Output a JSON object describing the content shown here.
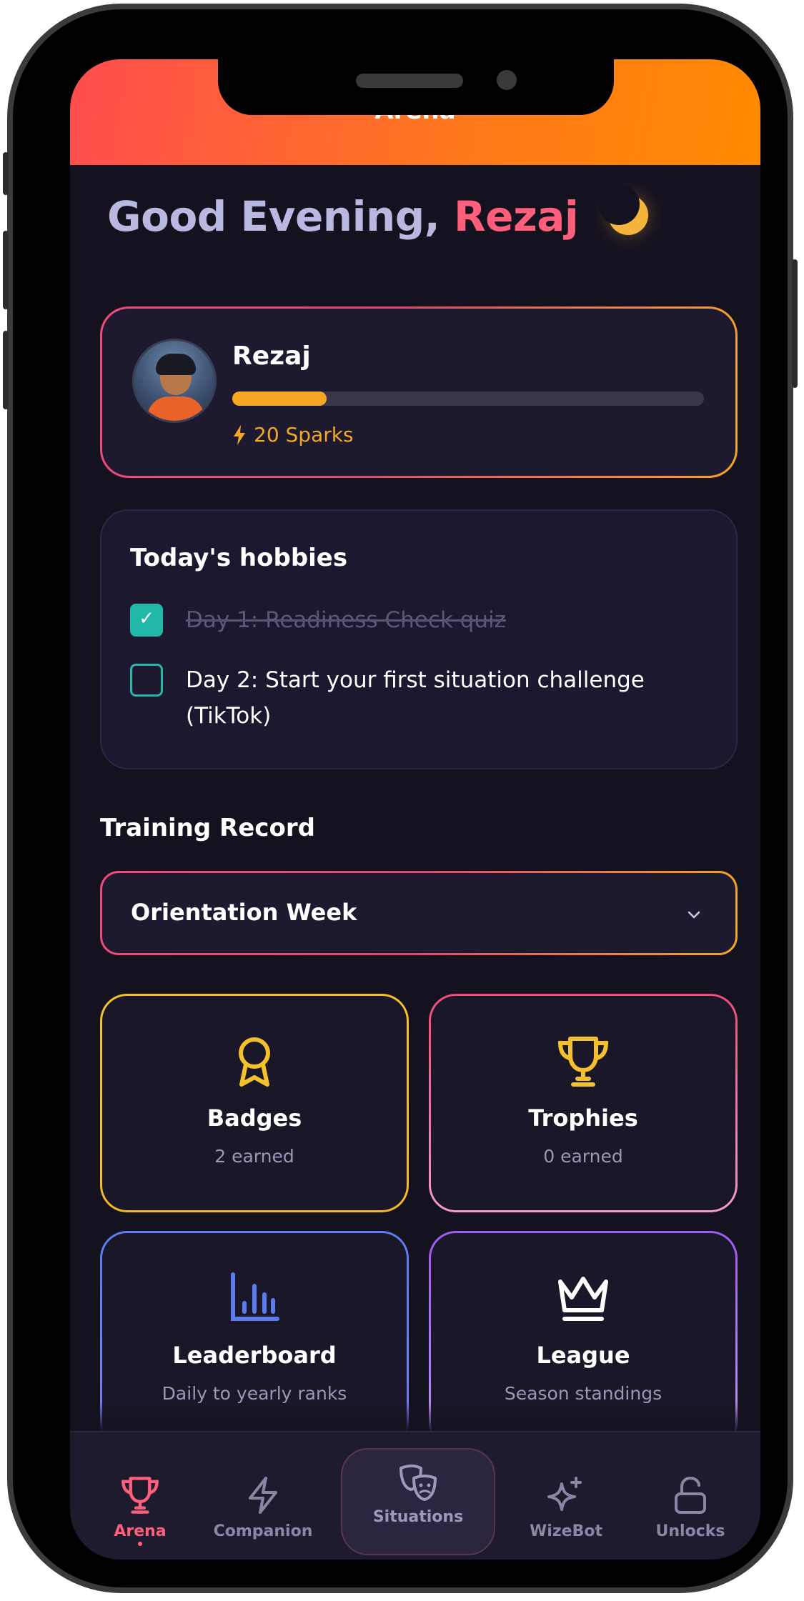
{
  "header": {
    "title": "Arena"
  },
  "greeting": {
    "prefix": "Good Evening,",
    "name": "Rezaj"
  },
  "profile": {
    "name": "Rezaj",
    "progress_fraction": 0.2,
    "sparks": "20 Sparks"
  },
  "hobbies": {
    "title": "Today's hobbies",
    "tasks": [
      {
        "label": "Day 1: Readiness Check quiz",
        "done": true
      },
      {
        "label": "Day 2: Start your first situation challenge (TikTok)",
        "done": false
      }
    ]
  },
  "training": {
    "label": "Training Record",
    "selected": "Orientation Week"
  },
  "tiles": [
    {
      "title": "Badges",
      "subtitle": "2 earned",
      "icon": "ribbon-icon",
      "color": "#f5c12a"
    },
    {
      "title": "Trophies",
      "subtitle": "0 earned",
      "icon": "trophy-icon",
      "color": "#f5c12a"
    },
    {
      "title": "Leaderboard",
      "subtitle": "Daily to yearly ranks",
      "icon": "bar-chart-icon",
      "color": "#5b7cf0"
    },
    {
      "title": "League",
      "subtitle": "Season standings",
      "icon": "crown-icon",
      "color": "#ffffff"
    }
  ],
  "tabbar": {
    "items": [
      {
        "label": "Arena",
        "icon": "trophy-icon",
        "active": true
      },
      {
        "label": "Companion",
        "icon": "lightning-icon",
        "active": false
      },
      {
        "label": "Situations",
        "icon": "masks-icon",
        "active": false
      },
      {
        "label": "WizeBot",
        "icon": "sparkle-icon",
        "active": false
      },
      {
        "label": "Unlocks",
        "icon": "unlock-icon",
        "active": false
      }
    ]
  },
  "colors": {
    "accent": "#ff5f7a",
    "orange": "#f5a623",
    "teal": "#22b8a8",
    "background": "#15121f"
  }
}
